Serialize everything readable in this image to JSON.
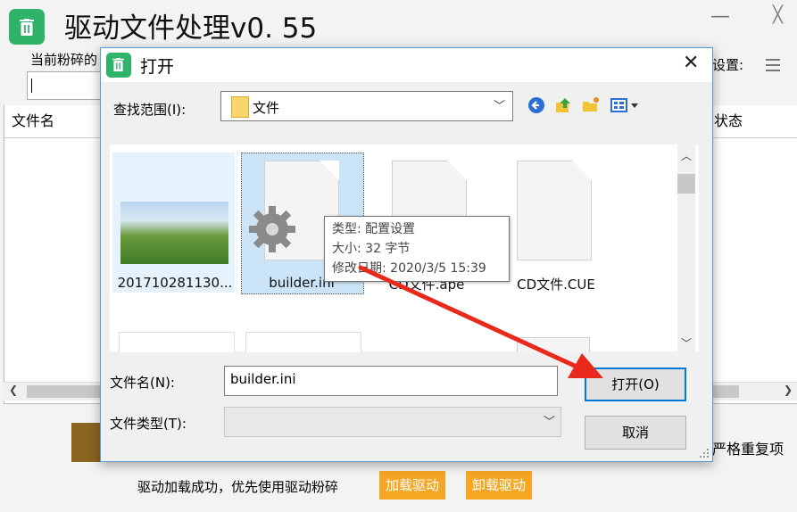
{
  "app": {
    "title": "驱动文件处理v0. 55",
    "minimize_glyph": "—",
    "close_glyph": "╳",
    "current_shred_label": "当前粉碎的",
    "settings_label": "设置:",
    "menu_icon": "hamburger-menu-icon",
    "columns": {
      "filename": "文件名",
      "status": "状态"
    },
    "strict_duplicates_label": "严格重复项",
    "status_message": "驱动加载成功，优先使用驱动粉碎",
    "load_driver_button": "加载驱动",
    "unload_driver_button": "卸载驱动",
    "accent_green": "#2fb36a",
    "accent_orange": "#f5a623"
  },
  "dialog": {
    "title": "打开",
    "close_glyph": "✕",
    "look_in_label": "查找范围(I):",
    "look_in_value": "文件",
    "files": [
      {
        "name": "201710281130...",
        "kind": "image"
      },
      {
        "name": "builder.ini",
        "kind": "config",
        "selected": true
      },
      {
        "name": "CD文件.ape",
        "kind": "file"
      },
      {
        "name": "CD文件.CUE",
        "kind": "file"
      }
    ],
    "tooltip": {
      "type": "类型: 配置设置",
      "size": "大小: 32 字节",
      "modified": "修改日期: 2020/3/5 15:39"
    },
    "filename_label": "文件名(N):",
    "filename_value": "builder.ini",
    "filetype_label": "文件类型(T):",
    "open_button": "打开(O)",
    "cancel_button": "取消",
    "highlight_color": "#0078d7",
    "annotation_arrow_color": "#e8291c"
  }
}
